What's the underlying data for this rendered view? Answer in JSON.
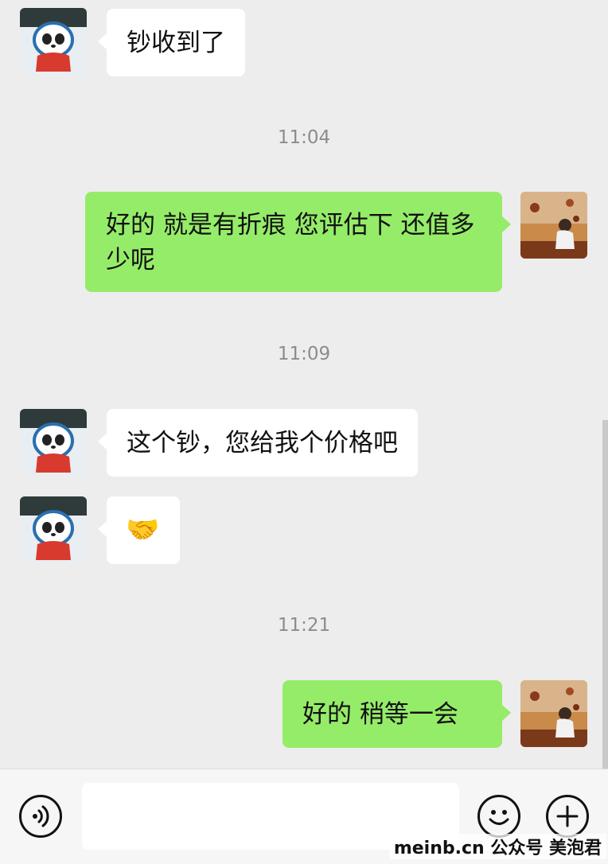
{
  "messages": [
    {
      "type": "received",
      "text": "钞收到了"
    },
    {
      "type": "time",
      "text": "11:04"
    },
    {
      "type": "sent",
      "text": "好的 就是有折痕 您评估下 还值多少呢"
    },
    {
      "type": "time",
      "text": "11:09"
    },
    {
      "type": "received",
      "text": "这个钞，您给我个价格吧"
    },
    {
      "type": "received",
      "text": "🤝"
    },
    {
      "type": "time",
      "text": "11:21"
    },
    {
      "type": "sent",
      "text": "好的 稍等一会"
    }
  ],
  "input": {
    "placeholder": "",
    "value": ""
  },
  "icons": {
    "voice": "voice-icon",
    "emoji": "emoji-icon",
    "plus": "plus-icon"
  },
  "watermark": "meinb.cn 公众号 美泡君",
  "colors": {
    "sent_bubble": "#95ec69",
    "received_bubble": "#ffffff",
    "background": "#ededed"
  }
}
